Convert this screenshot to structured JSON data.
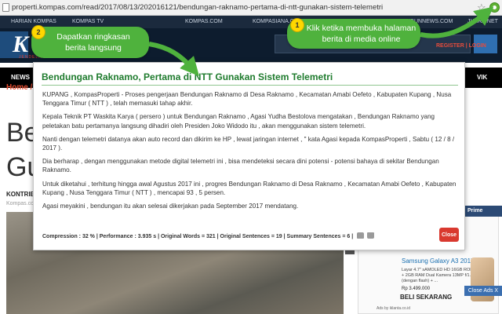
{
  "browser": {
    "url": "properti.kompas.com/read/2017/08/13/202016121/bendungan-raknamo-pertama-di-ntt-gunakan-sistem-telemetri"
  },
  "site": {
    "top_nav": [
      "HARIAN KOMPAS",
      "KOMPAS TV",
      "KOMPAS.COM",
      "KOMPASIANA.COM",
      "TRIBUNNEWS.COM",
      "JUARA.NET"
    ],
    "logo_letter": "K",
    "logo_sub": "JENDELA PROPERTI",
    "login": "REGISTER | LOGIN",
    "nav_news": "NEWS",
    "nav_vik": "VIK",
    "breadcrumb": "Home / P",
    "headline_1": "Be",
    "headline_2": "Gu",
    "contributor": "KONTRIBUTOR",
    "contributor_sub": "Kompas.com",
    "promo": "Prime"
  },
  "ad": {
    "title": "Samsung Galaxy A3 2017",
    "desc": "Layar 4.7\" sAMOLED HD 16GB ROM + 2GB RAM Dual Kamera 13MP f/1.9 (dengan flash) + ...",
    "price": "Rp 3.499.000",
    "buy": "BELI SEKARANG",
    "close": "Close Ads X",
    "footer": "Ads by iklanta.co.id"
  },
  "summary": {
    "title": "Bendungan Raknamo, Pertama di NTT Gunakan Sistem Telemetri",
    "paragraphs": [
      "KUPANG , KompasProperti - Proses pengerjaan Bendungan Raknamo di Desa Raknamo , Kecamatan Amabi Oefeto , Kabupaten Kupang , Nusa Tenggara Timur ( NTT ) , telah memasuki tahap akhir.",
      "Kepala Teknik PT Waskita Karya ( persero ) untuk Bendungan Raknamo , Agasi Yudha Bestolova mengatakan , Bendungan Raknamo yang peletakan batu pertamanya langsung dihadiri oleh Presiden Joko Widodo itu , akan menggunakan sistem telemetri.",
      "Nanti dengan telemetri datanya akan auto record dan dikirim ke HP , lewat jaringan internet , \" kata Agasi kepada KompasProperti , Sabtu ( 12 / 8 / 2017 ).",
      "Dia berharap , dengan menggunakan metode digital telemetri ini , bisa mendeteksi secara dini potensi - potensi bahaya di sekitar Bendungan Raknamo.",
      "Untuk diketahui , terhitung hingga awal Agustus 2017 ini , progres Bendungan Raknamo di Desa Raknamo , Kecamatan Amabi Oefeto , Kabupaten Kupang , Nusa Tenggara Timur ( NTT ) , mencapai 93 , 5 persen.",
      "Agasi meyakini , bendungan itu akan selesai dikerjakan pada September 2017 mendatang."
    ],
    "stats": "Compression : 32 % | Performance : 3.935 s | Original Words = 321 | Original Sentences = 19 | Summary Sentences = 6 |",
    "close_label": "Close"
  },
  "callouts": {
    "one": {
      "number": "1",
      "text_line1": "Klik ketika membuka halaman",
      "text_line2": "berita di media online"
    },
    "two": {
      "number": "2",
      "text_line1": "Dapatkan ringkasan",
      "text_line2": "berita langsung"
    }
  },
  "colors": {
    "callout_green": "#4fb23d",
    "badge_yellow": "#ffd700",
    "title_green": "#1e7b2d",
    "close_red": "#d9392f"
  }
}
